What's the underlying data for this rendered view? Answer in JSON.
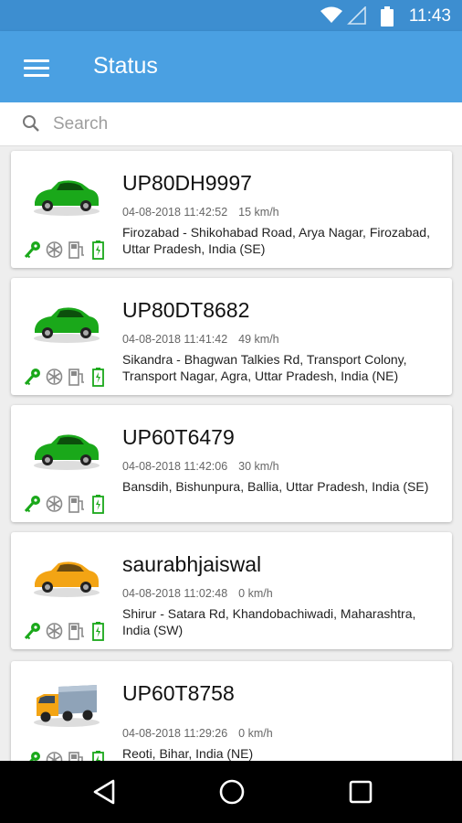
{
  "status_bar": {
    "time": "11:43",
    "icons": [
      "wifi-icon",
      "signal-icon",
      "battery-icon"
    ]
  },
  "app_bar": {
    "title": "Status",
    "menu_icon": "hamburger-menu-icon"
  },
  "search": {
    "placeholder": "Search",
    "value": ""
  },
  "vehicles": [
    {
      "plate": "UP80DH9997",
      "datetime": "04-08-2018 11:42:52",
      "speed": "15 km/h",
      "address": "Firozabad - Shikohabad Road,  Arya Nagar, Firozabad, Uttar Pradesh,  India (SE)",
      "icon": "green-car-icon",
      "color": "#1aa81a"
    },
    {
      "plate": "UP80DT8682",
      "datetime": "04-08-2018 11:41:42",
      "speed": "49 km/h",
      "address": "Sikandra - Bhagwan Talkies Rd, Transport Colony, Transport Nagar, Agra, Uttar Pradesh,  India (NE)",
      "icon": "green-car-icon",
      "color": "#1aa81a"
    },
    {
      "plate": "UP60T6479",
      "datetime": "04-08-2018 11:42:06",
      "speed": "30 km/h",
      "address": "Bansdih, Bishunpura, Ballia, Uttar Pradesh, India (SE)",
      "icon": "green-car-icon",
      "color": "#1aa81a"
    },
    {
      "plate": "saurabhjaiswal",
      "datetime": "04-08-2018 11:02:48",
      "speed": "0 km/h",
      "address": "Shirur - Satara Rd, Khandobachiwadi, Maharashtra,  India (SW)",
      "icon": "yellow-car-icon",
      "color": "#f3a414"
    },
    {
      "plate": "UP60T8758",
      "datetime": "04-08-2018 11:29:26",
      "speed": "0 km/h",
      "address": "Reoti, Bihar, India (NE)",
      "icon": "truck-icon",
      "color": "#f3a414"
    }
  ],
  "status_icon_names": [
    "ignition-key-icon",
    "ac-snowflake-icon",
    "fuel-pump-icon",
    "battery-charge-icon"
  ],
  "colors": {
    "primary": "#4aa0e2",
    "primary_dark": "#3d8ed0",
    "status_green": "#1aa81a"
  },
  "nav_bar": {
    "buttons": [
      "back-icon",
      "home-icon",
      "recents-icon"
    ]
  }
}
